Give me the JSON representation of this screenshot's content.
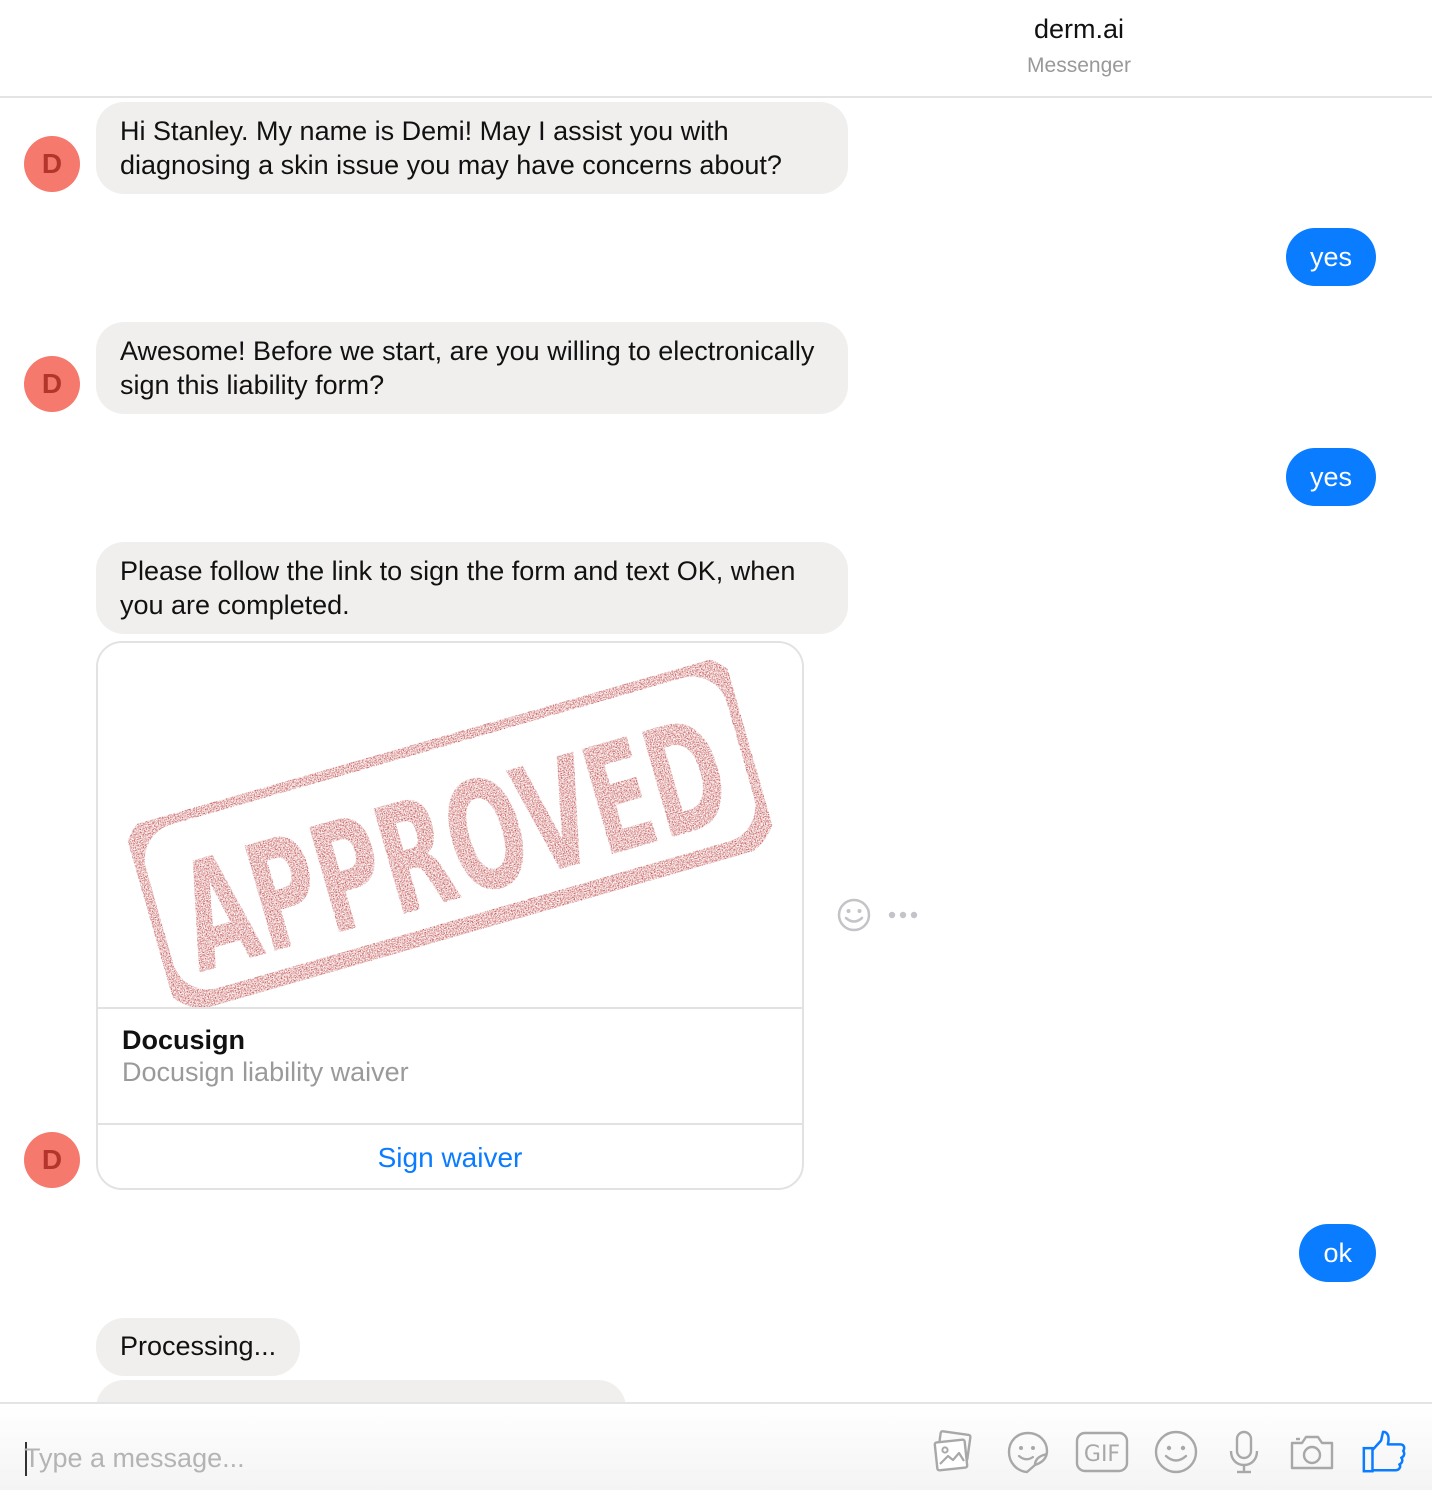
{
  "header": {
    "title": "derm.ai",
    "subtitle": "Messenger"
  },
  "bot": {
    "avatar_letter": "D"
  },
  "messages": [
    {
      "from": "bot",
      "text": "Hi Stanley. My name is Demi!  May I assist you with diagnosing a skin issue you may have concerns about?"
    },
    {
      "from": "user",
      "text": "yes"
    },
    {
      "from": "bot",
      "text": "Awesome! Before we start, are you willing to electronically sign this liability form?"
    },
    {
      "from": "user",
      "text": "yes"
    },
    {
      "from": "bot",
      "text": "Please follow the link to sign the form and text OK, when you are completed."
    },
    {
      "from": "user",
      "text": "ok"
    },
    {
      "from": "bot",
      "text": "Processing..."
    }
  ],
  "card": {
    "image_stamp_text": "APPROVED",
    "title": "Docusign",
    "subtitle": "Docusign liability waiver",
    "button_label": "Sign waiver"
  },
  "composer": {
    "placeholder": "Type a message...",
    "icons": [
      "photo-icon",
      "sticker-icon",
      "gif-icon",
      "emoji-icon",
      "microphone-icon",
      "camera-icon",
      "thumbs-up-icon"
    ],
    "gif_label": "GIF"
  },
  "colors": {
    "accent": "#0a7cff",
    "avatar_bg": "#f5796d",
    "avatar_fg": "#b3352c",
    "bubble_in": "#f0efee",
    "stamp": "#b01a1a"
  }
}
